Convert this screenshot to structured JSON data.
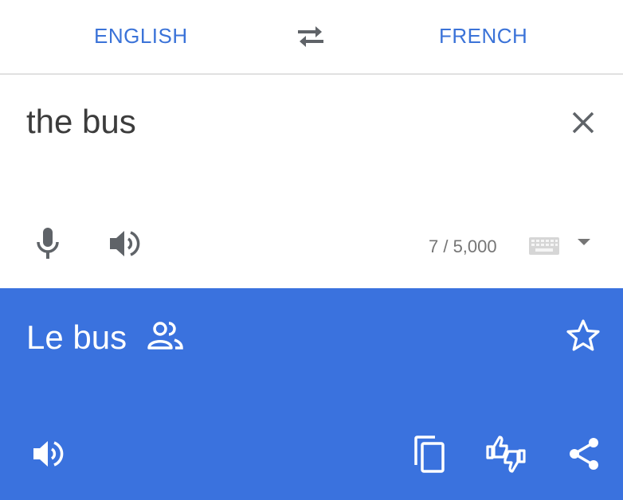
{
  "languages": {
    "source": "ENGLISH",
    "target": "FRENCH",
    "swap_icon": "swap-arrows-icon"
  },
  "input": {
    "text": "the bus",
    "char_count": "7 / 5,000",
    "icons": [
      "close-icon",
      "microphone-icon",
      "speaker-icon",
      "keyboard-icon",
      "caret-down-icon"
    ]
  },
  "output": {
    "text": "Le bus",
    "icons": [
      "community-verified-icon",
      "star-outline-icon",
      "speaker-icon",
      "copy-icon",
      "feedback-thumbs-icon",
      "share-icon"
    ],
    "background_color": "#3a72de"
  },
  "colors": {
    "accent": "#3b73d8",
    "output_bg": "#3a72de",
    "icon_gray": "#5f6368"
  }
}
